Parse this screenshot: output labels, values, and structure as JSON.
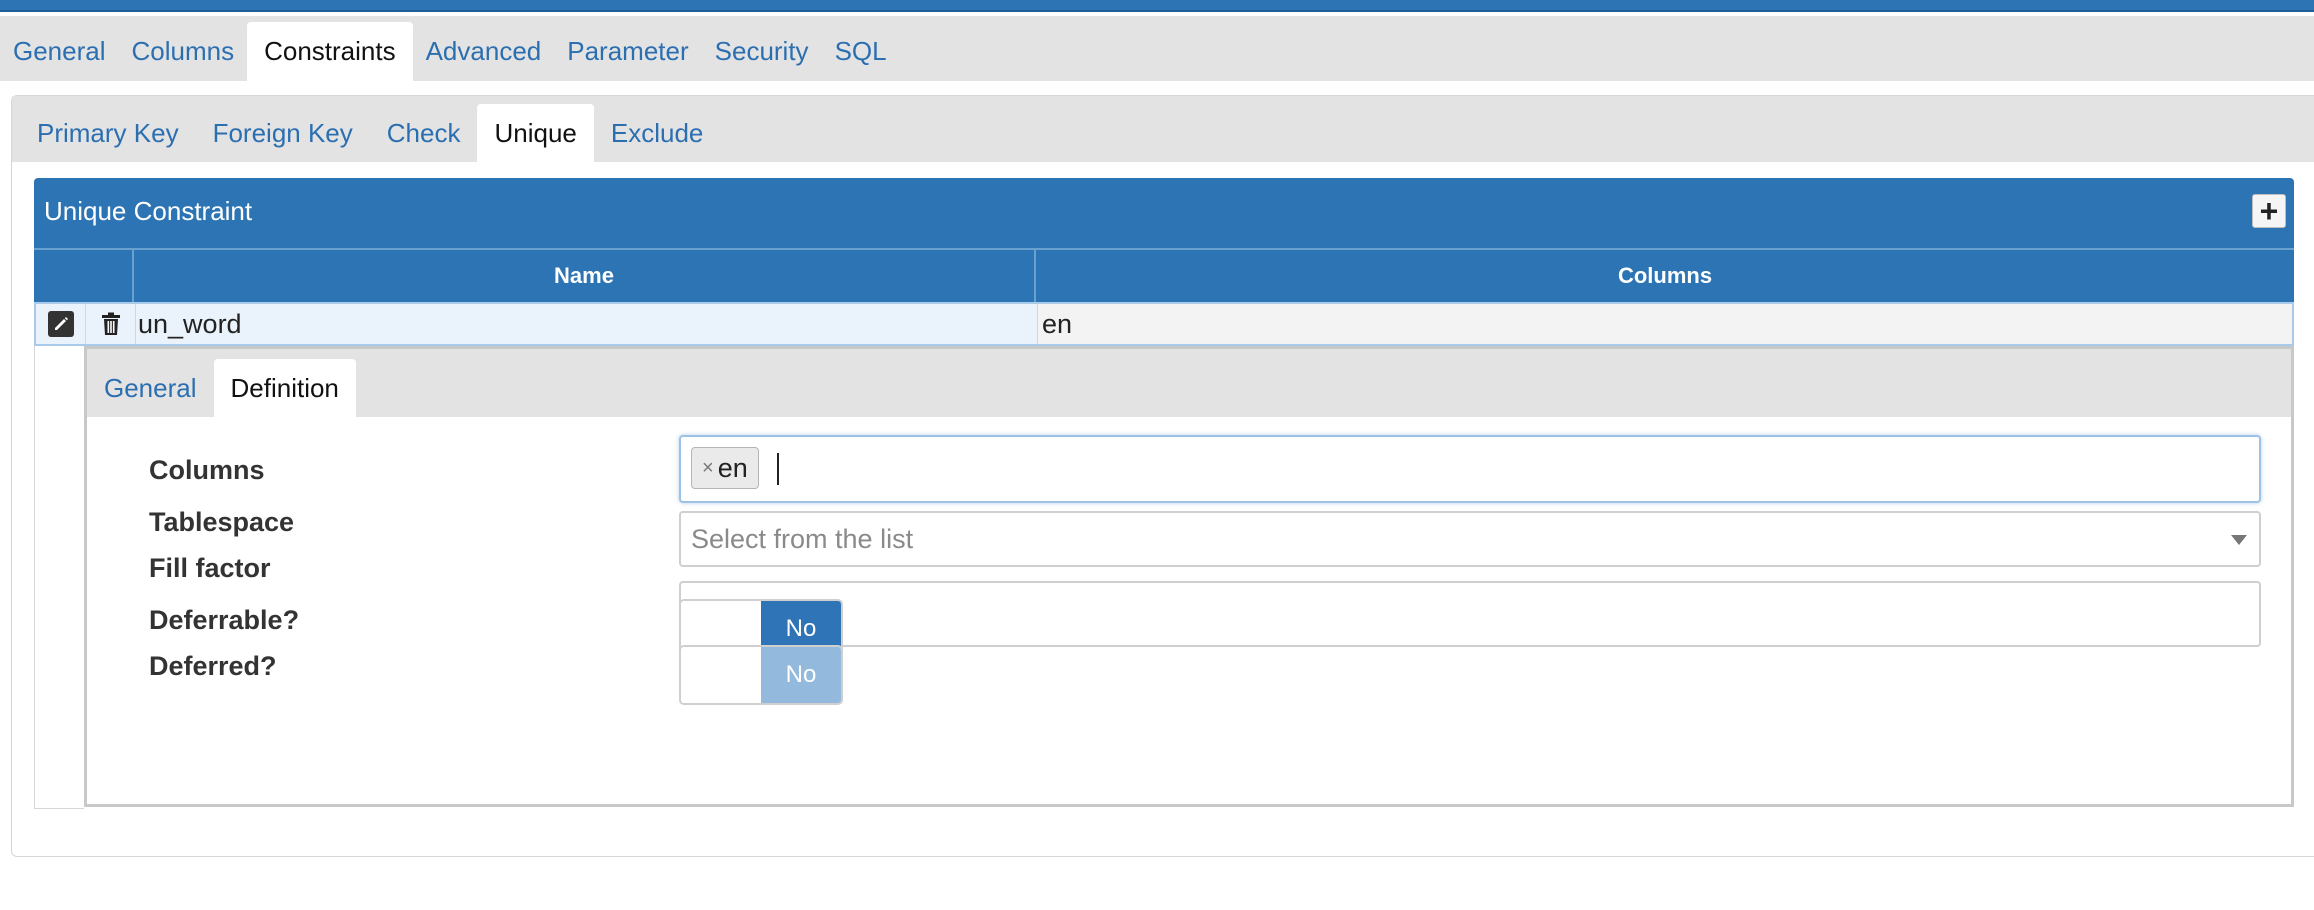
{
  "main_tabs": [
    {
      "label": "General"
    },
    {
      "label": "Columns"
    },
    {
      "label": "Constraints",
      "active": true
    },
    {
      "label": "Advanced"
    },
    {
      "label": "Parameter"
    },
    {
      "label": "Security"
    },
    {
      "label": "SQL"
    }
  ],
  "constraint_tabs": [
    {
      "label": "Primary Key"
    },
    {
      "label": "Foreign Key"
    },
    {
      "label": "Check"
    },
    {
      "label": "Unique",
      "active": true
    },
    {
      "label": "Exclude"
    }
  ],
  "grid": {
    "title": "Unique Constraint",
    "add_label": "+",
    "columns": [
      "Name",
      "Columns"
    ],
    "rows": [
      {
        "name": "un_word",
        "columns": "en"
      }
    ]
  },
  "detail": {
    "tabs": [
      {
        "label": "General"
      },
      {
        "label": "Definition",
        "active": true
      }
    ],
    "fields": {
      "columns_label": "Columns",
      "columns_tags": [
        "en"
      ],
      "tag_remove": "×",
      "tablespace_label": "Tablespace",
      "tablespace_placeholder": "Select from the list",
      "fill_factor_label": "Fill factor",
      "fill_factor_value": "",
      "deferrable_label": "Deferrable?",
      "deferrable_value": "No",
      "deferred_label": "Deferred?",
      "deferred_value": "No"
    }
  },
  "colors": {
    "accent": "#2c74b3",
    "link": "#2c6fb1",
    "toggle_on": "#2f74b6",
    "toggle_disabled": "#93b9dc"
  },
  "icons": [
    "edit-icon",
    "trash-icon",
    "plus-icon",
    "dropdown-arrow-icon",
    "tag-remove-icon"
  ]
}
